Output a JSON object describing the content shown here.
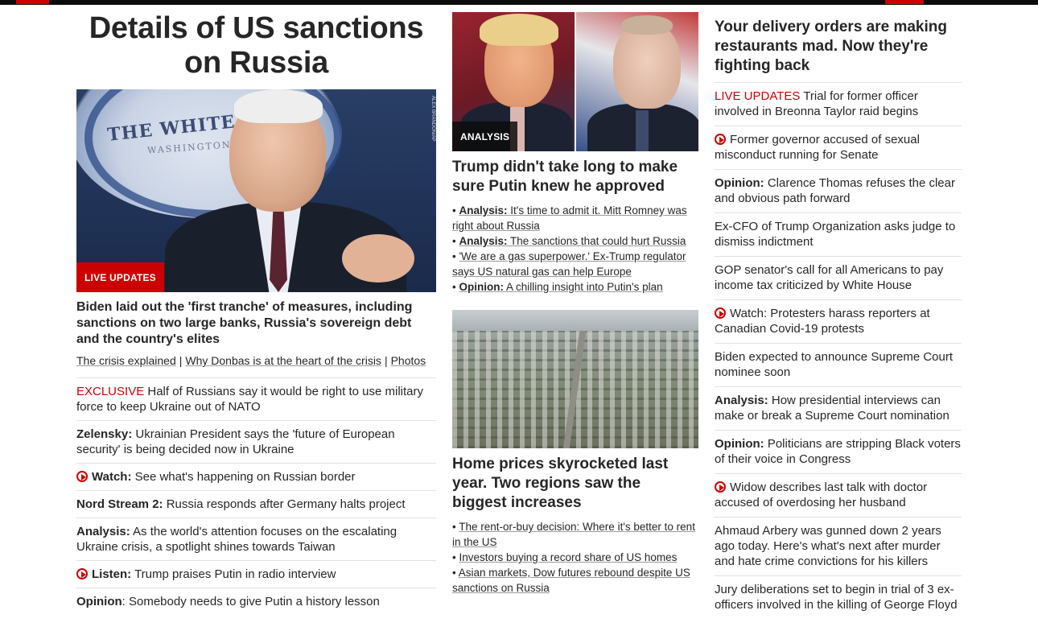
{
  "topbar": {
    "accent": "#cc0000"
  },
  "col1": {
    "headline": "Details of US sanctions on Russia",
    "hero": {
      "badge": "LIVE UPDATES",
      "seal_text": "THE WHITE H",
      "seal_sub": "WASHINGTON",
      "credit": "ALEX BRANDON/AP"
    },
    "subheadline": "Biden laid out the 'first tranche' of measures, including sanctions on two large banks, Russia's sovereign debt and the country's elites",
    "related": [
      "The crisis explained",
      "Why Donbas is at the heart of the crisis",
      "Photos"
    ],
    "related_sep": "|",
    "items": [
      {
        "label": "EXCLUSIVE",
        "text": " Half of Russians say it would be right to use military force to keep Ukraine out of NATO"
      },
      {
        "label": "Zelensky:",
        "text": " Ukrainian President says the 'future of European security' is being decided now in Ukraine"
      },
      {
        "label": "Watch:",
        "text": " See what's happening on Russian border"
      },
      {
        "label": "Nord Stream 2:",
        "text": " Russia responds after Germany halts project"
      },
      {
        "label": "Analysis:",
        "text": " As the world's attention focuses on the escalating Ukraine crisis, a spotlight shines towards Taiwan"
      },
      {
        "label": "Listen:",
        "text": " Trump praises Putin in radio interview"
      },
      {
        "label": "Opinion",
        "text": ": Somebody needs to give Putin a history lesson"
      }
    ]
  },
  "col2": {
    "story1": {
      "badge": "ANALYSIS",
      "headline": "Trump didn't take long to make sure Putin knew he approved",
      "bullets": [
        {
          "label": "Analysis:",
          "text": " It's time to admit it. Mitt Romney was right about Russia"
        },
        {
          "label": "Analysis:",
          "text": " The sanctions that could hurt Russia"
        },
        {
          "label": "",
          "text": "'We are a gas superpower.' Ex-Trump regulator says US natural gas can help Europe"
        },
        {
          "label": "Opinion:",
          "text": " A chilling insight into Putin's plan"
        }
      ]
    },
    "story2": {
      "headline": "Home prices skyrocketed last year. Two regions saw the biggest increases",
      "bullets": [
        {
          "text": "The rent-or-buy decision: Where it's better to rent in the US"
        },
        {
          "text": "Investors buying a record share of US homes"
        },
        {
          "text": "Asian markets, Dow futures rebound despite US sanctions on Russia"
        }
      ]
    }
  },
  "col3": {
    "headline": "Your delivery orders are making restaurants mad. Now they're fighting back",
    "items": [
      {
        "label": "LIVE UPDATES",
        "text": " Trial for former officer involved in Breonna Taylor raid begins"
      },
      {
        "text": "Former governor accused of sexual misconduct running for Senate"
      },
      {
        "label": "Opinion:",
        "text": " Clarence Thomas refuses the clear and obvious path forward"
      },
      {
        "text": "Ex-CFO of Trump Organization asks judge to dismiss indictment"
      },
      {
        "text": "GOP senator's call for all Americans to pay income tax criticized by White House"
      },
      {
        "text": "Watch: Protesters harass reporters at Canadian Covid-19 protests"
      },
      {
        "text": "Biden expected to announce Supreme Court nominee soon"
      },
      {
        "label": "Analysis:",
        "text": " How presidential interviews can make or break a Supreme Court nomination"
      },
      {
        "label": "Opinion:",
        "text": " Politicians are stripping Black voters of their voice in Congress"
      },
      {
        "text": "Widow describes last talk with doctor accused of overdosing her husband"
      },
      {
        "text": "Ahmaud Arbery was gunned down 2 years ago today. Here's what's next after murder and hate crime convictions for his killers"
      },
      {
        "text": "Jury deliberations set to begin in trial of 3 ex-officers involved in the killing of George Floyd"
      }
    ]
  }
}
